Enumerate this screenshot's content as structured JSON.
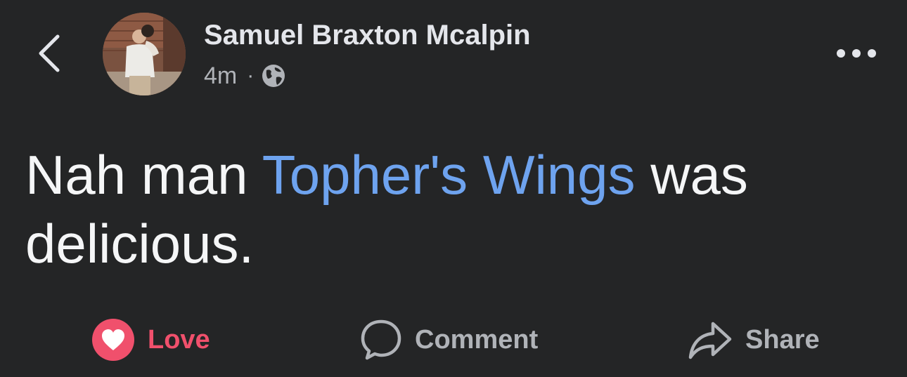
{
  "post": {
    "author": "Samuel Braxton Mcalpin",
    "time": "4m",
    "separator": "·",
    "audience_icon": "globe-icon",
    "text_before": "Nah man ",
    "tagged_page": "Topher's Wings",
    "text_after": " was delicious."
  },
  "nav": {
    "back_icon": "chevron-left-icon",
    "more_icon": "more-options-icon"
  },
  "actions": {
    "love_label": "Love",
    "comment_label": "Comment",
    "share_label": "Share"
  },
  "colors": {
    "background": "#242526",
    "text_primary": "#f5f6f7",
    "text_secondary": "#b0b3b8",
    "link": "#6ea3ef",
    "love": "#f0506c"
  }
}
